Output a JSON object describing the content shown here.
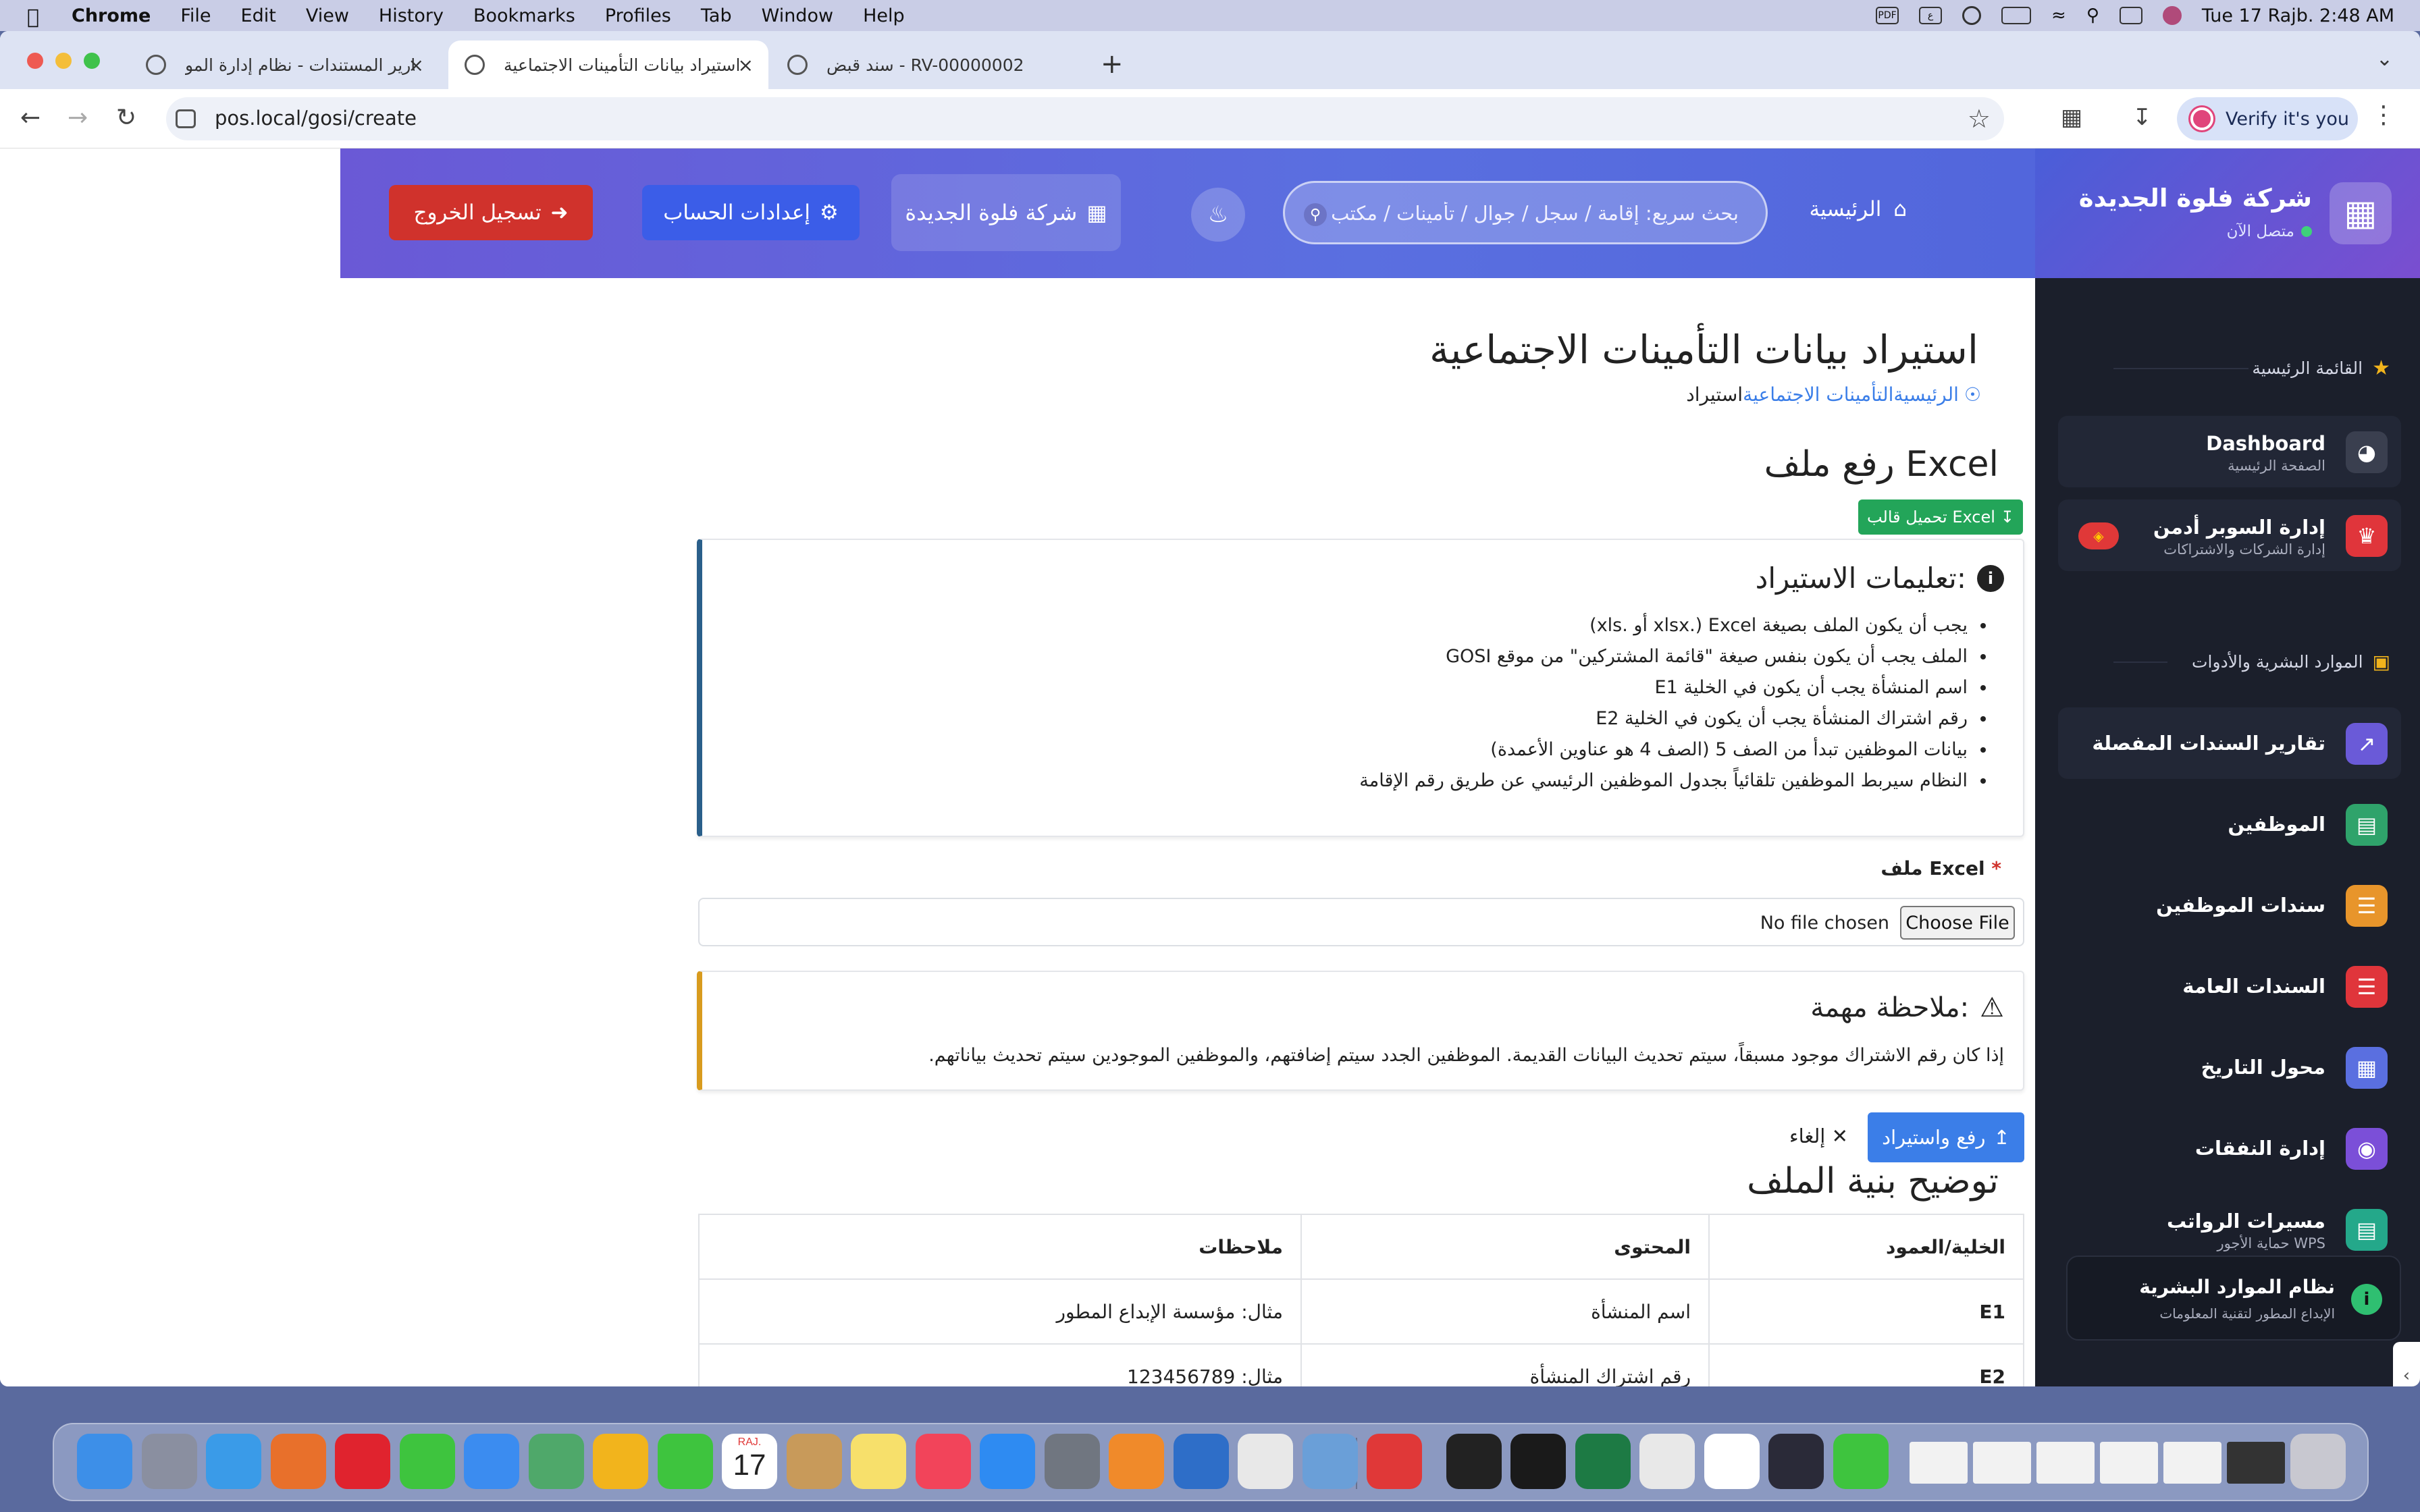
{
  "menubar": {
    "app": "Chrome",
    "items": [
      "File",
      "Edit",
      "View",
      "History",
      "Bookmarks",
      "Profiles",
      "Tab",
      "Window",
      "Help"
    ],
    "clock": "Tue 17 Rajb.  2:48 AM",
    "icons": [
      "pdf-icon",
      "arabic-input-icon",
      "user-icon",
      "battery-icon",
      "wifi-icon",
      "search-icon",
      "control-center-icon",
      "avatar-icon"
    ]
  },
  "tabs": [
    {
      "title": "تقارير المستندات - نظام إدارة المو",
      "active": false
    },
    {
      "title": "استيراد بيانات التأمينات الاجتماعية",
      "active": true
    },
    {
      "title": "سند قبض - RV-00000002",
      "active": false
    }
  ],
  "toolbar": {
    "url": "pos.local/gosi/create",
    "verify_label": "Verify it's you"
  },
  "topnav": {
    "home": "الرئيسية",
    "search_placeholder": "بحث سريع: إقامة / سجل / جوال / تأمينات / مكتب",
    "company": "شركة فلوة الجديدة",
    "account": "إعدادات الحساب",
    "logout": "تسجيل الخروج"
  },
  "sidebar": {
    "company": "شركة فلوة الجديدة",
    "status": "متصل الآن",
    "section_main": "القائمة الرئيسية",
    "section_hr": "الموارد البشرية والأدوات",
    "items": [
      {
        "title": "Dashboard",
        "sub": "الصفحة الرئيسية",
        "icon": "gauge-icon",
        "color": "#3a3f4f"
      },
      {
        "title": "إدارة السوبر أدمن",
        "sub": "إدارة الشركات والاشتراكات",
        "icon": "crown-icon",
        "color": "#e0353b"
      },
      {
        "title": "تقارير السندات المفصلة",
        "sub": "",
        "icon": "chart-line-icon",
        "color": "#6a5ad8"
      },
      {
        "title": "الموظفين",
        "sub": "",
        "icon": "id-card-icon",
        "color": "#2fa36b"
      },
      {
        "title": "سندات الموظفين",
        "sub": "",
        "icon": "document-icon",
        "color": "#e8952b"
      },
      {
        "title": "السندات العامة",
        "sub": "",
        "icon": "file-red-icon",
        "color": "#e0353b"
      },
      {
        "title": "محول التاريخ",
        "sub": "",
        "icon": "calendar-icon",
        "color": "#5a6fe0"
      },
      {
        "title": "إدارة النفقات",
        "sub": "",
        "icon": "money-icon",
        "color": "#7b4fd8"
      },
      {
        "title": "مسيرات الرواتب",
        "sub": "حماية الأجور WPS",
        "icon": "payroll-icon",
        "color": "#24a88a"
      }
    ],
    "footer_title": "نظام الموارد البشرية",
    "footer_sub": "الإبداع المطور لتقنية المعلومات"
  },
  "page": {
    "title": "استيراد بيانات التأمينات الاجتماعية",
    "breadcrumb": [
      "الرئيسية",
      "التأمينات الاجتماعية",
      "استيراد"
    ],
    "upload_title": "رفع ملف Excel",
    "template_button": "تحميل قالب Excel",
    "instructions_title": "تعليمات الاستيراد:",
    "instructions": [
      "يجب أن يكون الملف بصيغة Excel (.xlsx أو .xls)",
      "الملف يجب أن يكون بنفس صيغة \"قائمة المشتركين\" من موقع GOSI",
      "اسم المنشأة يجب أن يكون في الخلية E1",
      "رقم اشتراك المنشأة يجب أن يكون في الخلية E2",
      "بيانات الموظفين تبدأ من الصف 5 (الصف 4 هو عناوين الأعمدة)",
      "النظام سيربط الموظفين تلقائياً بجدول الموظفين الرئيسي عن طريق رقم الإقامة"
    ],
    "file_label": "ملف Excel",
    "choose_file": "Choose File",
    "no_file": "No file chosen",
    "note_title": "ملاحظة مهمة:",
    "note_text": "إذا كان رقم الاشتراك موجود مسبقاً، سيتم تحديث البيانات القديمة. الموظفين الجدد سيتم إضافتهم، والموظفين الموجودين سيتم تحديث بياناتهم.",
    "import_button": "رفع واستيراد",
    "cancel_button": "إلغاء",
    "structure_title": "توضيح بنية الملف",
    "table_headers": [
      "الخلية/العمود",
      "المحتوى",
      "ملاحظات"
    ],
    "table_rows": [
      [
        "E1",
        "اسم المنشأة",
        "مثال: مؤسسة الإبداع المطور"
      ],
      [
        "E2",
        "رقم اشتراك المنشأة",
        "مثال: 123456789"
      ]
    ]
  },
  "dock": {
    "apps": [
      "finder-icon",
      "launchpad-icon",
      "safari-icon",
      "firefox-icon",
      "opera-icon",
      "messages-icon",
      "mail-icon",
      "maps-icon",
      "photos-icon",
      "facetime-icon",
      "calendar-icon",
      "contacts-icon",
      "notes-icon",
      "music-icon",
      "app-store-icon",
      "settings-icon",
      "sublime-icon",
      "remote-desktop-icon",
      "tool-icon",
      "preview-icon",
      "pdf-expert-icon",
      "terminal-icon",
      "vpn-icon",
      "excel-icon",
      "chrome-icon",
      "chatgpt-icon",
      "bbedit-icon",
      "whatsapp-icon",
      "window-thumb-1",
      "window-thumb-2",
      "window-thumb-3",
      "window-thumb-4",
      "window-thumb-5",
      "window-thumb-6",
      "trash-icon"
    ],
    "calendar_month": "RAJ.",
    "calendar_day": "17"
  }
}
